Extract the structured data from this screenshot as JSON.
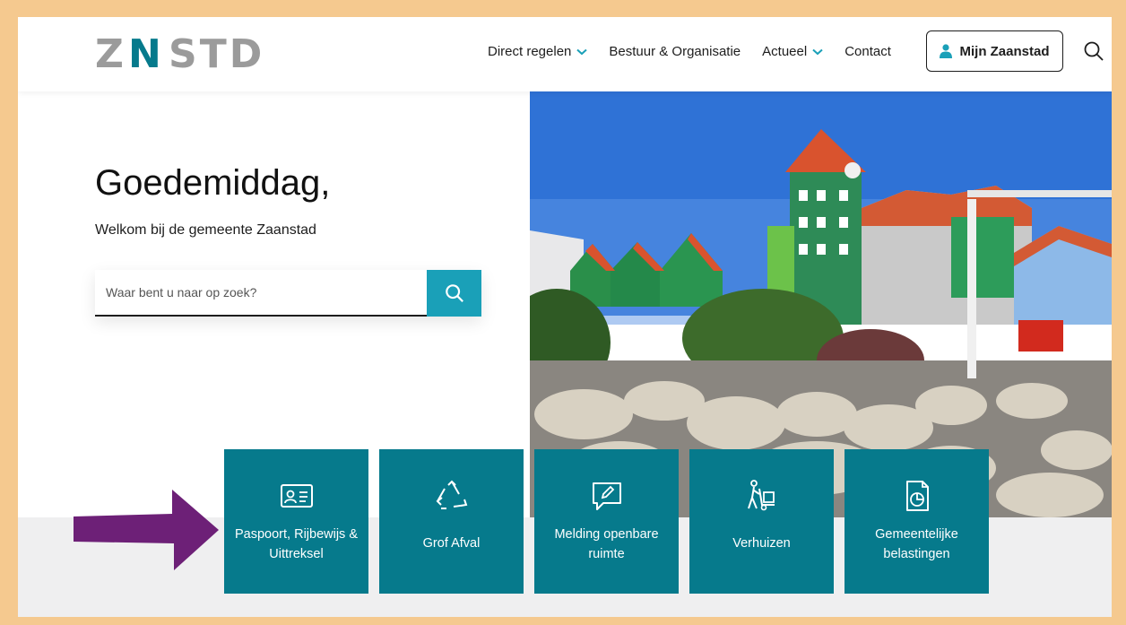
{
  "header": {
    "logo_text": "ZNSTD",
    "nav": [
      {
        "label": "Direct regelen",
        "has_dropdown": true
      },
      {
        "label": "Bestuur & Organisatie",
        "has_dropdown": false
      },
      {
        "label": "Actueel",
        "has_dropdown": true
      },
      {
        "label": "Contact",
        "has_dropdown": false
      }
    ],
    "account_button": "Mijn Zaanstad"
  },
  "hero": {
    "greeting": "Goedemiddag,",
    "welcome": "Welkom bij de gemeente Zaanstad",
    "search_placeholder": "Waar bent u naar op zoek?"
  },
  "tiles": [
    {
      "label": "Paspoort, Rijbewijs & Uittreksel",
      "icon": "id-card-icon"
    },
    {
      "label": "Grof Afval",
      "icon": "recycle-icon"
    },
    {
      "label": "Melding openbare ruimte",
      "icon": "speech-pencil-icon"
    },
    {
      "label": "Verhuizen",
      "icon": "moving-person-icon"
    },
    {
      "label": "Gemeentelijke belastingen",
      "icon": "tax-document-icon"
    }
  ],
  "colors": {
    "teal": "#067a8c",
    "search_button": "#1aa0b8",
    "border_frame": "#f5c98f",
    "arrow": "#6d2077"
  }
}
